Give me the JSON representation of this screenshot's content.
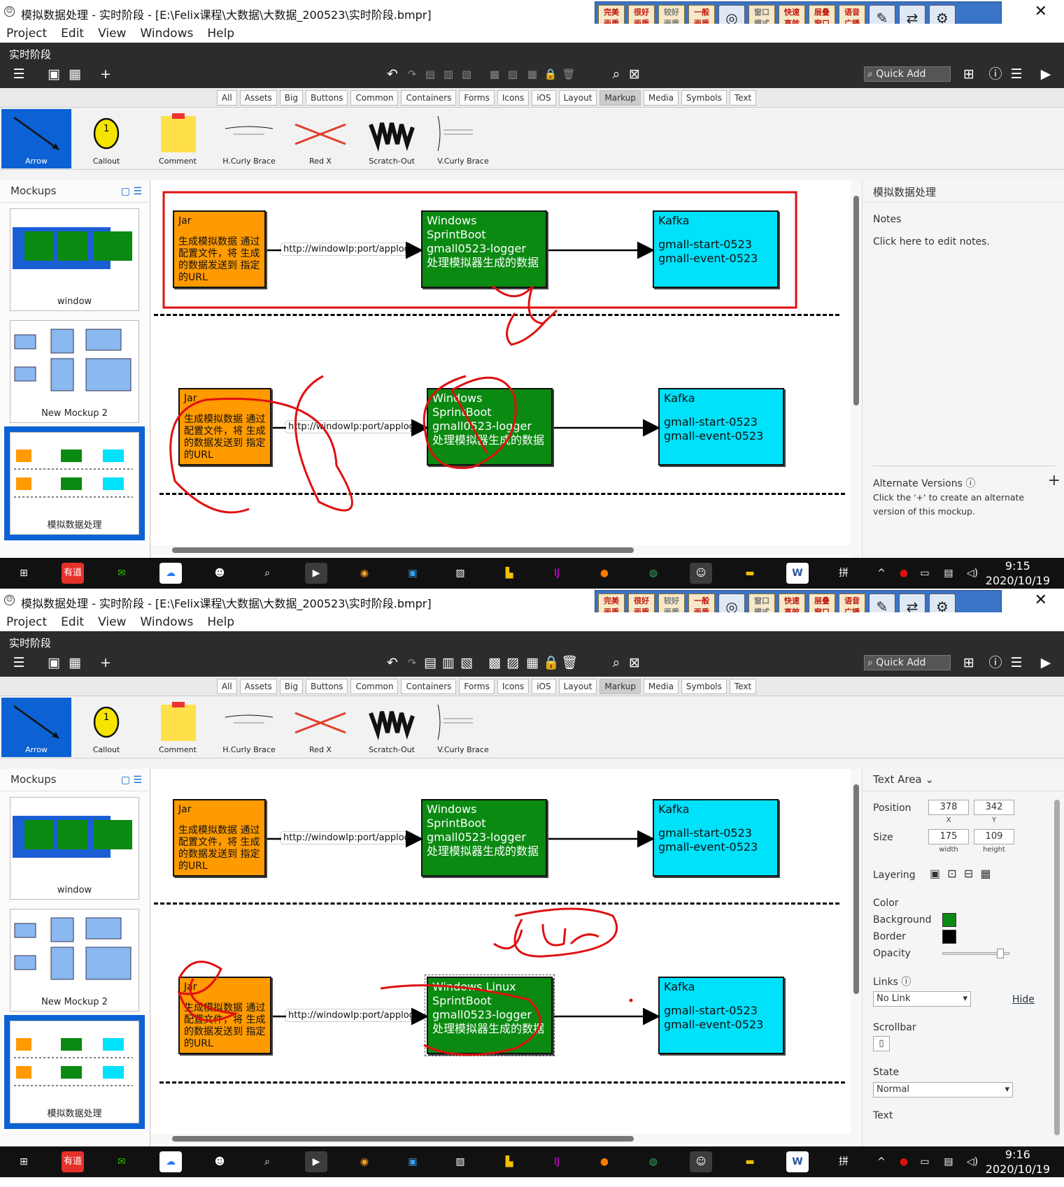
{
  "window": {
    "title": "模拟数据处理 - 实时阶段 - [E:\\Felix课程\\大数据\\大数据_200523\\实时阶段.bmpr]",
    "app_icon": "smiley-icon"
  },
  "ime_toolbar": {
    "keys": [
      "完美\n画质",
      "很好\n画质",
      "较好\n画质",
      "一般\n画质",
      "窗口\n模式",
      "快速\n高效",
      "层叠\n窗口",
      "语音\n广播"
    ]
  },
  "menu": [
    "Project",
    "Edit",
    "Windows",
    "Help"
  ],
  "mockup_name": "实时阶段",
  "quick_add": "Quick Add",
  "library_tabs": [
    "All",
    "Assets",
    "Big",
    "Buttons",
    "Common",
    "Containers",
    "Forms",
    "Icons",
    "iOS",
    "Layout",
    "Markup",
    "Media",
    "Symbols",
    "Text"
  ],
  "library_selected_tab": "Markup",
  "library_items": [
    "Arrow",
    "Callout",
    "Comment",
    "H.Curly Brace",
    "Red X",
    "Scratch-Out",
    "V.Curly Brace"
  ],
  "mockups_panel": {
    "title": "Mockups",
    "items": [
      "window",
      "New Mockup 2",
      "模拟数据处理"
    ]
  },
  "diagram": {
    "jar_title": "Jar",
    "jar_text": "生成模拟数据 通过配置文件，将 生成的数据发送到 指定的URL",
    "url_label": "http://windowIp:port/applog",
    "logger_line1": "Windows",
    "logger_line1_edited": "Windows Linux",
    "logger_line2": "SprintBoot",
    "logger_line3": "gmall0523-logger",
    "logger_line4": "处理模拟器生成的数据",
    "kafka_title": "Kafka",
    "kafka_topic1": "gmall-start-0523",
    "kafka_topic2": "gmall-event-0523"
  },
  "notes_panel": {
    "title": "模拟数据处理",
    "notes_label": "Notes",
    "notes_hint": "Click here to edit notes.",
    "alt_versions_label": "Alternate Versions",
    "alt_versions_hint": "Click the '+' to create an alternate version of this mockup."
  },
  "properties_panel": {
    "title": "Text Area",
    "position_label": "Position",
    "x": "378",
    "y": "342",
    "x_cap": "X",
    "y_cap": "Y",
    "size_label": "Size",
    "width": "175",
    "height": "109",
    "width_cap": "width",
    "height_cap": "height",
    "layering_label": "Layering",
    "color_label": "Color",
    "background_label": "Background",
    "border_label": "Border",
    "opacity_label": "Opacity",
    "background_color": "#0b8a12",
    "border_color": "#000000",
    "opacity": 0.9,
    "links_label": "Links",
    "link_value": "No Link",
    "hide_label": "Hide",
    "scrollbar_label": "Scrollbar",
    "state_label": "State",
    "state_value": "Normal",
    "text_label": "Text"
  },
  "taskbar": {
    "apps": [
      "windows-start-icon",
      "youdao-icon",
      "wechat-icon",
      "baidu-netdisk-icon",
      "avatar-icon",
      "search-tool-icon",
      "media-player-icon",
      "browser-icon",
      "remote-desktop-icon",
      "photo-viewer-icon",
      "app-store-icon",
      "intellij-icon",
      "firefox-icon",
      "chrome-icon",
      "emoji-icon",
      "file-explorer-icon",
      "word-icon"
    ],
    "youdao_label": "有道",
    "ime_label": "拼",
    "time_top": "9:15",
    "time_bottom": "9:16",
    "date": "2020/10/19"
  },
  "colors": {
    "accent": "#0c62d4",
    "jar_box": "#ff9a00",
    "logger_box": "#0b8a12",
    "kafka_box": "#00e1fa",
    "annotation": "#e01010"
  }
}
